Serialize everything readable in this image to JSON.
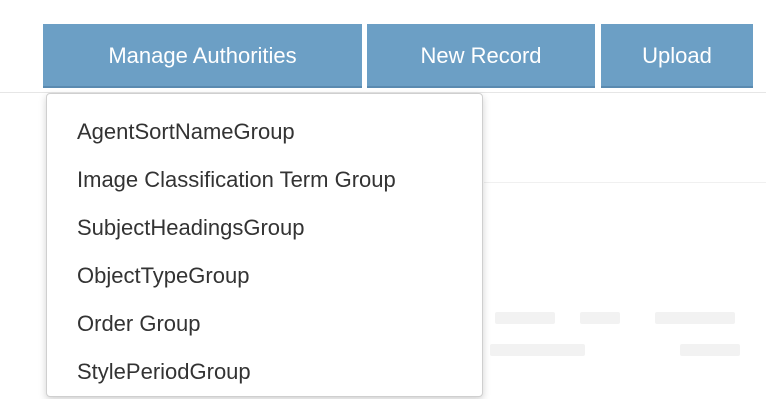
{
  "toolbar": {
    "manage_label": "Manage Authorities",
    "new_record_label": "New Record",
    "upload_label": "Upload"
  },
  "dropdown": {
    "items": [
      "AgentSortNameGroup",
      "Image Classification Term Group",
      "SubjectHeadingsGroup",
      "ObjectTypeGroup",
      "Order Group",
      "StylePeriodGroup"
    ]
  },
  "colors": {
    "button_bg": "#6c9fc5",
    "button_text": "#ffffff",
    "menu_text": "#333333",
    "menu_border": "#cfcfcf"
  }
}
